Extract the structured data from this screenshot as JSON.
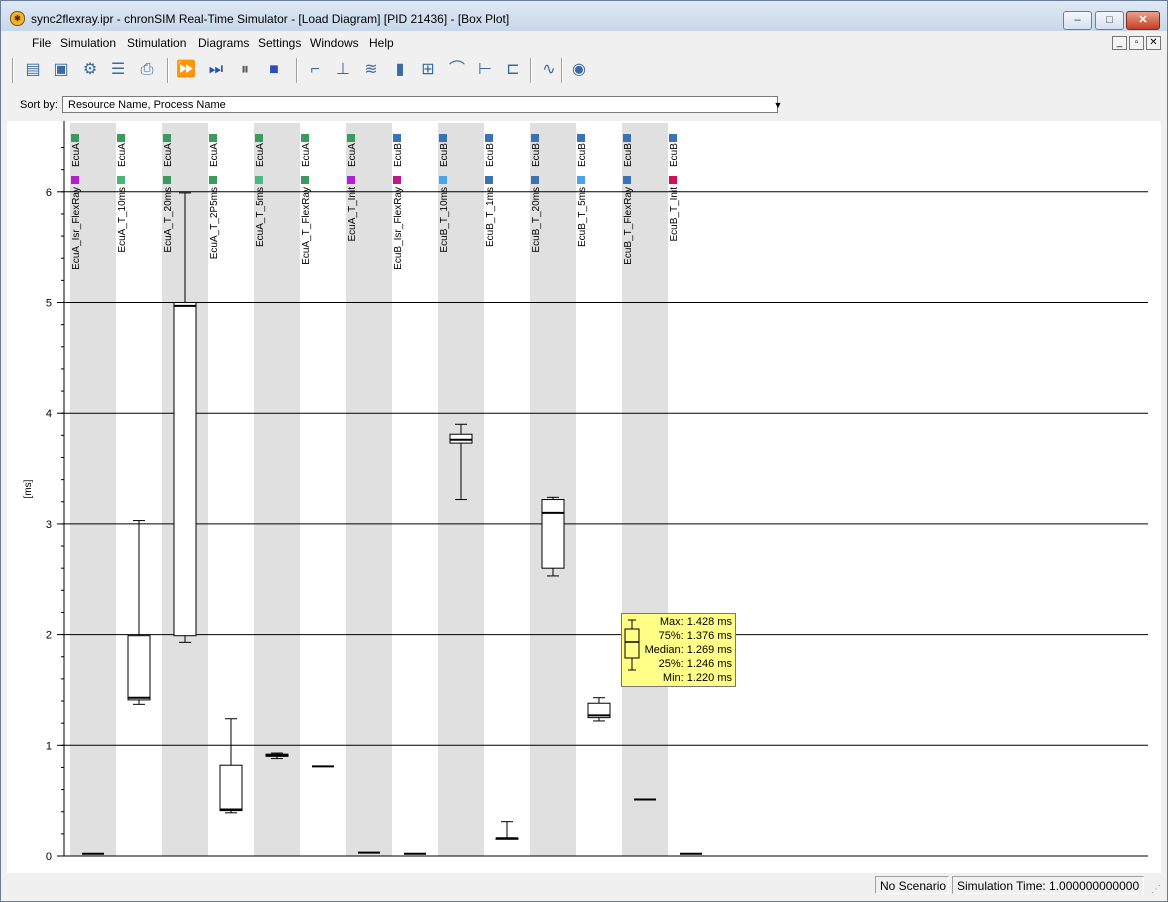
{
  "window": {
    "title": "sync2flexray.ipr - chronSIM Real-Time Simulator - [Load Diagram] [PID 21436] - [Box Plot]",
    "app_icon": "chronsim-app-icon",
    "caption_buttons": {
      "minimize": "–",
      "maximize": "□",
      "close": "✕"
    }
  },
  "menu": {
    "items": [
      "File",
      "Simulation",
      "Stimulation",
      "Diagrams",
      "Settings",
      "Windows",
      "Help"
    ],
    "mdi_buttons": [
      "_",
      "▫",
      "✕"
    ]
  },
  "toolbar": {
    "icons": [
      "open-project-icon",
      "save-trace-icon",
      "settings-gear-icon",
      "document-icon",
      "print-icon",
      "fast-forward-icon",
      "step-forward-icon",
      "pause-icon",
      "stop-icon",
      "state-diagram-icon",
      "task-tree-icon",
      "load-lines-icon",
      "bar-chart-icon",
      "box-plot-icon",
      "curve-icon",
      "timeline-icon",
      "range-icon",
      "signal-icon",
      "eye-icon"
    ]
  },
  "sort": {
    "label": "Sort by:",
    "value": "Resource Name, Process Name"
  },
  "chart_data": {
    "type": "box",
    "ylabel": "[ms]",
    "ylim": [
      0,
      6.5
    ],
    "yticks": [
      "0",
      "1",
      "2",
      "3",
      "4",
      "5",
      "6"
    ],
    "grid": true,
    "columns": [
      {
        "ecu": "EcuA",
        "process": "EcuA_Isr_FlexRay",
        "ecu_color": "#3c9a5f",
        "proc_color": "#b01fd0",
        "min": 0.02,
        "q1": 0.02,
        "median": 0.02,
        "q3": 0.02,
        "max": 0.02
      },
      {
        "ecu": "EcuA",
        "process": "EcuA_T_10ms",
        "ecu_color": "#3c9a5f",
        "proc_color": "#45b77a",
        "min": 1.37,
        "q1": 1.41,
        "median": 1.43,
        "q3": 1.99,
        "max": 3.03
      },
      {
        "ecu": "EcuA",
        "process": "EcuA_T_20ms",
        "ecu_color": "#3c9a5f",
        "proc_color": "#3c9a5f",
        "min": 1.93,
        "q1": 1.99,
        "median": 4.97,
        "q3": 5.0,
        "max": 5.99
      },
      {
        "ecu": "EcuA",
        "process": "EcuA_T_2P5ms",
        "ecu_color": "#3c9a5f",
        "proc_color": "#3c9a5f",
        "min": 0.39,
        "q1": 0.41,
        "median": 0.42,
        "q3": 0.82,
        "max": 1.24
      },
      {
        "ecu": "EcuA",
        "process": "EcuA_T_5ms",
        "ecu_color": "#3c9a5f",
        "proc_color": "#4cba80",
        "min": 0.88,
        "q1": 0.9,
        "median": 0.91,
        "q3": 0.92,
        "max": 0.93
      },
      {
        "ecu": "EcuA",
        "process": "EcuA_T_FlexRay",
        "ecu_color": "#3c9a5f",
        "proc_color": "#3c9a5f",
        "min": 0.8,
        "q1": 0.8,
        "median": 0.81,
        "q3": 0.82,
        "max": 0.82
      },
      {
        "ecu": "EcuA",
        "process": "EcuA_T_Init",
        "ecu_color": "#3c9a5f",
        "proc_color": "#b01fd0",
        "min": 0.03,
        "q1": 0.03,
        "median": 0.03,
        "q3": 0.03,
        "max": 0.03
      },
      {
        "ecu": "EcuB",
        "process": "EcuB_Isr_FlexRay",
        "ecu_color": "#3a73b5",
        "proc_color": "#c0178a",
        "min": 0.02,
        "q1": 0.02,
        "median": 0.02,
        "q3": 0.02,
        "max": 0.02
      },
      {
        "ecu": "EcuB",
        "process": "EcuB_T_10ms",
        "ecu_color": "#3a73b5",
        "proc_color": "#4aa3e8",
        "min": 3.22,
        "q1": 3.73,
        "median": 3.76,
        "q3": 3.81,
        "max": 3.9
      },
      {
        "ecu": "EcuB",
        "process": "EcuB_T_1ms",
        "ecu_color": "#3a73b5",
        "proc_color": "#3a73b5",
        "min": 0.16,
        "q1": 0.16,
        "median": 0.16,
        "q3": 0.16,
        "max": 0.31
      },
      {
        "ecu": "EcuB",
        "process": "EcuB_T_20ms",
        "ecu_color": "#3a73b5",
        "proc_color": "#3a73b5",
        "min": 2.53,
        "q1": 2.6,
        "median": 3.1,
        "q3": 3.22,
        "max": 3.24
      },
      {
        "ecu": "EcuB",
        "process": "EcuB_T_5ms",
        "ecu_color": "#3a73b5",
        "proc_color": "#4aa3e8",
        "min": 1.22,
        "q1": 1.25,
        "median": 1.27,
        "q3": 1.38,
        "max": 1.43
      },
      {
        "ecu": "EcuB",
        "process": "EcuB_T_FlexRay",
        "ecu_color": "#3a73b5",
        "proc_color": "#3a73b5",
        "min": 0.5,
        "q1": 0.5,
        "median": 0.51,
        "q3": 0.51,
        "max": 0.51
      },
      {
        "ecu": "EcuB",
        "process": "EcuB_T_Init",
        "ecu_color": "#3a73b5",
        "proc_color": "#d0105a",
        "min": 0.02,
        "q1": 0.02,
        "median": 0.02,
        "q3": 0.02,
        "max": 0.02
      }
    ]
  },
  "tooltip": {
    "lines": [
      "Max: 1.428 ms",
      "75%: 1.376 ms",
      "Median: 1.269 ms",
      "25%: 1.246 ms",
      "Min: 1.220 ms"
    ]
  },
  "status": {
    "scenario": "No Scenario",
    "sim_time": "Simulation Time: 1.000000000000 s"
  }
}
